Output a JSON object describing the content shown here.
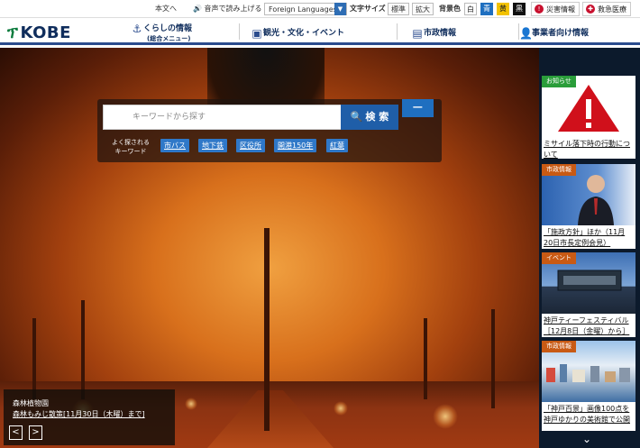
{
  "util": {
    "skip": "本文へ",
    "voice": "音声で読み上げる",
    "lang": "Foreign Languages",
    "font_size_label": "文字サイズ",
    "font_std": "標準",
    "font_big": "拡大",
    "bg_label": "背景色",
    "bg_white": "白",
    "bg_blue": "青",
    "bg_yellow": "黄",
    "bg_black": "黒",
    "disaster": "災害情報",
    "emergency": "救急医療"
  },
  "header": {
    "logo": "KOBE",
    "nav": [
      {
        "label": "くらしの情報",
        "sub": "(総合メニュー)",
        "icon": "anchor-icon"
      },
      {
        "label": "観光・文化・イベント",
        "sub": "",
        "icon": "suitcase-icon"
      },
      {
        "label": "市政情報",
        "sub": "",
        "icon": "document-icon"
      },
      {
        "label": "事業者向け情報",
        "sub": "",
        "icon": "person-icon"
      }
    ]
  },
  "search": {
    "placeholder": "キーワードから探す",
    "button": "検 索",
    "keywords_label": "よく探される\nキーワード",
    "keywords": [
      "市バス",
      "地下鉄",
      "区役所",
      "開港150年",
      "紅葉"
    ],
    "collapse": "−"
  },
  "hero": {
    "caption_title": "森林植物園",
    "caption_link": "森林もみじ散策[11月30日（木曜）まで]",
    "prev": "<",
    "next": ">"
  },
  "sidebar": {
    "cards": [
      {
        "tag": "お知らせ",
        "tag_color": "#2a9d3a",
        "text": "ミサイル落下時の行動について"
      },
      {
        "tag": "市政情報",
        "tag_color": "#c85a14",
        "text": "「施政方針」ほか（11月20日市長定例会見）"
      },
      {
        "tag": "イベント",
        "tag_color": "#c85a14",
        "text": "神戸ティーフェスティバル［12月8日（金曜）から］"
      },
      {
        "tag": "市政情報",
        "tag_color": "#c85a14",
        "text": "「神戸百景」画像100点を神戸ゆかりの美術館で公開"
      }
    ]
  }
}
